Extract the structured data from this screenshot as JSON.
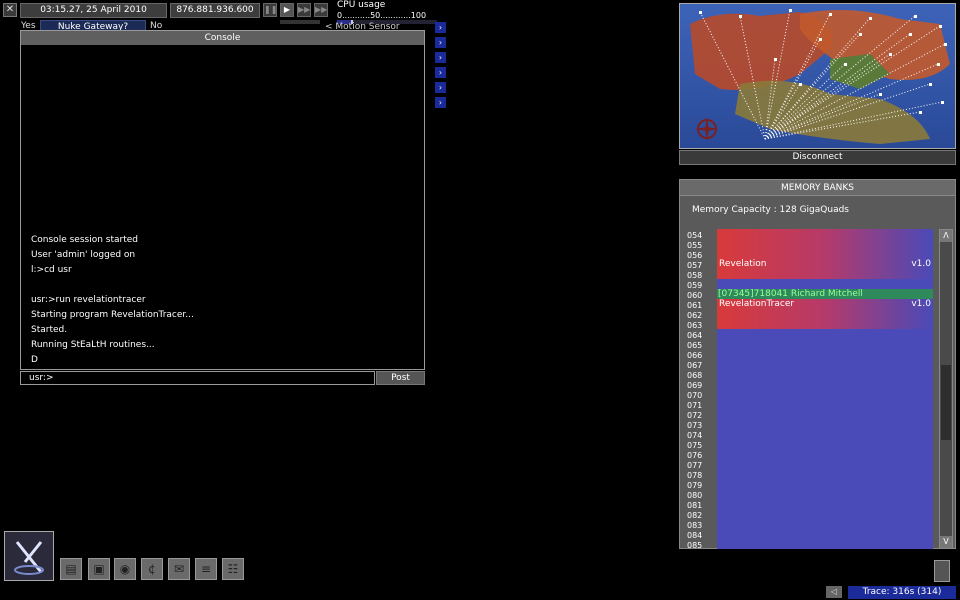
{
  "topbar": {
    "datetime": "03:15.27, 25 April 2010",
    "ip": "876.881.936.600",
    "cpu_title": "CPU usage",
    "cpu_scale": "0...........50............100"
  },
  "nuke": {
    "yes": "Yes",
    "label": "Nuke Gateway?",
    "no": "No"
  },
  "motion_fragment": "< Motion  Sensor",
  "fragments": {
    "s1": ":s",
    "s2": "s"
  },
  "console": {
    "title": "Console",
    "lines": [
      "Console session started",
      "User 'admin' logged on",
      "l:>cd usr",
      "",
      "usr:>run revelationtracer",
      "Starting program RevelationTracer...",
      "Started.",
      "Running StEaLtH routines...",
      "D"
    ],
    "input_value": "usr:>",
    "post_label": "Post"
  },
  "map": {
    "disconnect_label": "Disconnect"
  },
  "memory": {
    "title": "MEMORY BANKS",
    "capacity": "Memory Capacity : 128 GigaQuads",
    "rows": [
      "054",
      "055",
      "056",
      "057",
      "058",
      "059",
      "060",
      "061",
      "062",
      "063",
      "064",
      "065",
      "066",
      "067",
      "068",
      "069",
      "070",
      "071",
      "072",
      "073",
      "074",
      "075",
      "076",
      "077",
      "078",
      "079",
      "080",
      "081",
      "082",
      "083",
      "084",
      "085"
    ],
    "block1": {
      "name": "Revelation",
      "version": "v1.0"
    },
    "green_entry": "[07345]718041 Richard Mitchell",
    "block2": {
      "name": "RevelationTracer",
      "version": "v1.0"
    },
    "scroll_up": "Λ",
    "scroll_down": "V"
  },
  "trace": {
    "label": "Trace: 316s (314)"
  },
  "colors": {
    "accent_blue": "#1c2b9a",
    "memory_bg": "#4a4ab8",
    "program_red": "#d83a3a",
    "green_entry": "#2e8a5a"
  }
}
